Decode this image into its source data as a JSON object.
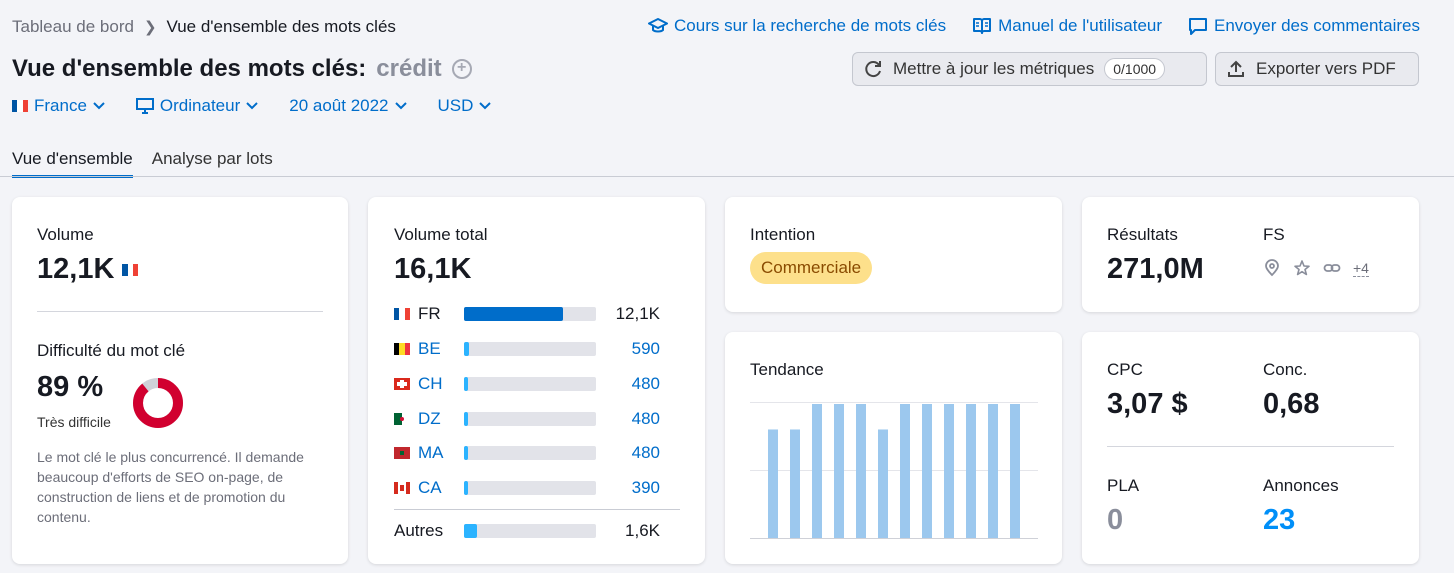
{
  "breadcrumb": {
    "home": "Tableau de bord",
    "current": "Vue d'ensemble des mots clés"
  },
  "toplinks": [
    {
      "label": "Cours sur la recherche de mots clés",
      "icon": "graduation-cap-icon"
    },
    {
      "label": "Manuel de l'utilisateur",
      "icon": "book-icon"
    },
    {
      "label": "Envoyer des commentaires",
      "icon": "chat-icon"
    }
  ],
  "title": {
    "prefix": "Vue d'ensemble des mots clés:",
    "keyword": "crédit"
  },
  "buttons": {
    "update": "Mettre à jour les métriques",
    "update_count": "0/1000",
    "export": "Exporter vers PDF"
  },
  "filters": {
    "country": "France",
    "device": "Ordinateur",
    "date": "20 août 2022",
    "currency": "USD"
  },
  "tabs": {
    "overview": "Vue d'ensemble",
    "bulk": "Analyse par lots"
  },
  "volume": {
    "label": "Volume",
    "value": "12,1K"
  },
  "difficulty": {
    "label": "Difficulté du mot clé",
    "value": "89 %",
    "level": "Très difficile",
    "percent": 89,
    "description": "Le mot clé le plus concurrencé. Il demande beaucoup d'efforts de SEO on-page, de construction de liens et de promotion du contenu."
  },
  "total_volume": {
    "label": "Volume total",
    "value": "16,1K",
    "rows": [
      {
        "code": "FR",
        "value": "12,1K",
        "share": 0.75
      },
      {
        "code": "BE",
        "value": "590",
        "share": 0.04
      },
      {
        "code": "CH",
        "value": "480",
        "share": 0.03
      },
      {
        "code": "DZ",
        "value": "480",
        "share": 0.03
      },
      {
        "code": "MA",
        "value": "480",
        "share": 0.03
      },
      {
        "code": "CA",
        "value": "390",
        "share": 0.03
      }
    ],
    "others": {
      "label": "Autres",
      "value": "1,6K",
      "share": 0.1
    }
  },
  "intent": {
    "label": "Intention",
    "badge": "Commerciale"
  },
  "trend": {
    "label": "Tendance",
    "values": [
      0.81,
      0.81,
      1,
      1,
      1,
      0.81,
      1,
      1,
      1,
      1,
      1,
      1
    ]
  },
  "results": {
    "label": "Résultats",
    "value": "271,0M",
    "fs_label": "FS",
    "fs_more": "+4"
  },
  "cpc": {
    "label": "CPC",
    "value": "3,07 $"
  },
  "competition": {
    "label": "Conc.",
    "value": "0,68"
  },
  "pla": {
    "label": "PLA",
    "value": "0"
  },
  "ads": {
    "label": "Annonces",
    "value": "23"
  },
  "colors": {
    "link": "#006dca",
    "difficulty": "#d1002f",
    "badge_bg": "#fde08b",
    "trend_bar": "#9cc8ee",
    "bar_primary": "#006dca",
    "bar_secondary": "#2bb3ff"
  }
}
